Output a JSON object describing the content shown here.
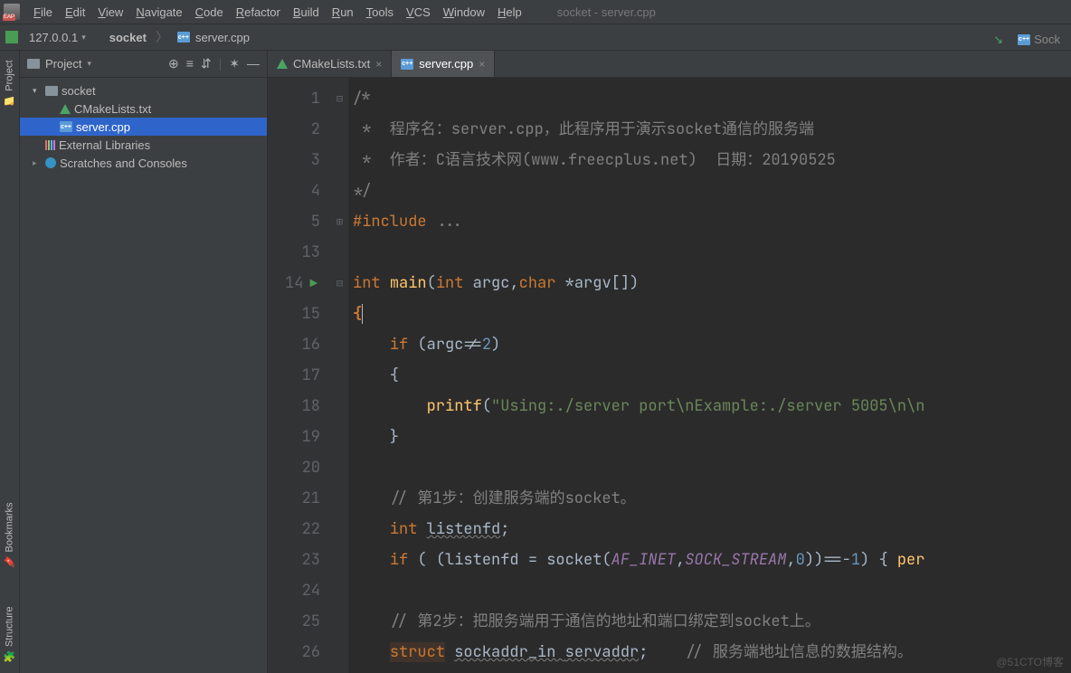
{
  "window_title": "socket - server.cpp",
  "menu": [
    "File",
    "Edit",
    "View",
    "Navigate",
    "Code",
    "Refactor",
    "Build",
    "Run",
    "Tools",
    "VCS",
    "Window",
    "Help"
  ],
  "run_ip": "127.0.0.1",
  "breadcrumb": {
    "project": "socket",
    "file": "server.cpp"
  },
  "topright_button": "Sock",
  "project_pane": {
    "title": "Project",
    "tree": [
      {
        "depth": 0,
        "arrow": "open",
        "icon": "dir",
        "label": "socket"
      },
      {
        "depth": 1,
        "arrow": "",
        "icon": "cmake",
        "label": "CMakeLists.txt"
      },
      {
        "depth": 1,
        "arrow": "",
        "icon": "cpp",
        "label": "server.cpp",
        "selected": true
      },
      {
        "depth": 0,
        "arrow": "",
        "icon": "lib",
        "label": "External Libraries"
      },
      {
        "depth": 0,
        "arrow": "closed",
        "icon": "scratch",
        "label": "Scratches and Consoles"
      }
    ]
  },
  "tabs": [
    {
      "icon": "cmake",
      "label": "CMakeLists.txt",
      "active": false
    },
    {
      "icon": "cpp",
      "label": "server.cpp",
      "active": true
    }
  ],
  "side_tabs": {
    "project": "Project",
    "bookmarks": "Bookmarks",
    "structure": "Structure"
  },
  "line_numbers": [
    1,
    2,
    3,
    4,
    5,
    13,
    14,
    15,
    16,
    17,
    18,
    19,
    20,
    21,
    22,
    23,
    24,
    25,
    26
  ],
  "runnable_line": 14,
  "caret_line": 15,
  "code_rows": [
    {
      "t": "comment",
      "text": "/*"
    },
    {
      "t": "comment",
      "text": " *  程序名：server.cpp，此程序用于演示socket通信的服务端"
    },
    {
      "t": "comment",
      "text": " *  作者：C语言技术网(www.freecplus.net)  日期：20190525"
    },
    {
      "t": "comment",
      "text": "*/"
    },
    {
      "t": "include",
      "kw": "#include ",
      "rest": "..."
    },
    {
      "t": "blank",
      "text": " "
    },
    {
      "t": "main",
      "pre": "int ",
      "fn": "main",
      "mid": "(",
      "kw2": "int ",
      "a1": "argc",
      "c": ",",
      "kw3": "char ",
      "a2": "*argv[]",
      "post": ")"
    },
    {
      "t": "brace",
      "text": "{"
    },
    {
      "t": "if1",
      "indent": "    ",
      "kw": "if ",
      "rest": "(argc!=",
      "num": "2",
      "close": ")"
    },
    {
      "t": "plain",
      "text": "    {"
    },
    {
      "t": "printf",
      "indent": "        ",
      "fn": "printf",
      "open": "(",
      "str": "\"Using:./server port\\nExample:./server 5005\\n\\n",
      "post": ""
    },
    {
      "t": "plain",
      "text": "    }"
    },
    {
      "t": "blank",
      "text": " "
    },
    {
      "t": "lcomment",
      "text": "    // 第1步：创建服务端的socket。"
    },
    {
      "t": "decl",
      "indent": "    ",
      "kw": "int ",
      "id": "listenfd",
      "semi": ";"
    },
    {
      "t": "if2",
      "indent": "    ",
      "kw": "if ",
      "open": "( (listenfd = socket(",
      "purple": "AF_INET",
      "c": ",",
      "purple2": "SOCK_STREAM",
      "c2": ",",
      "num": "0",
      "close": "))==-",
      "num2": "1",
      "brace": ") { ",
      "fn": "per"
    },
    {
      "t": "blank",
      "text": " "
    },
    {
      "t": "lcomment",
      "text": "    // 第2步：把服务端用于通信的地址和端口绑定到socket上。"
    },
    {
      "t": "struct",
      "indent": "    ",
      "kw": "struct",
      "sp": " ",
      "ty": "sockaddr_in ",
      "id": "servaddr",
      "semi": ";",
      "tail": "    // 服务端地址信息的数据结构。"
    }
  ],
  "watermark": "@51CTO博客"
}
